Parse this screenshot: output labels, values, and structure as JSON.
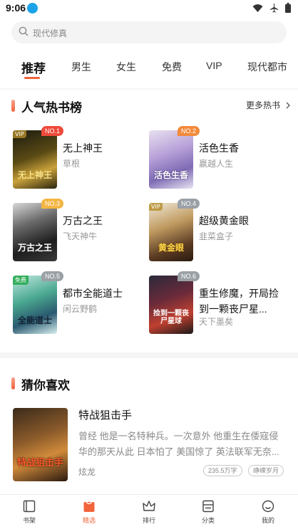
{
  "status": {
    "time": "9:06"
  },
  "search": {
    "placeholder": "现代修真"
  },
  "tabs": [
    {
      "label": "推荐",
      "active": true
    },
    {
      "label": "男生"
    },
    {
      "label": "女生"
    },
    {
      "label": "免费"
    },
    {
      "label": "VIP"
    },
    {
      "label": "现代都市"
    }
  ],
  "hot_list": {
    "title": "人气热书榜",
    "more": "更多热书",
    "items": [
      {
        "rank": "NO.1",
        "name": "无上神王",
        "author": "草根",
        "cover_title": "无上神王",
        "tag": "VIP"
      },
      {
        "rank": "NO.2",
        "name": "活色生香",
        "author": "嬴越人生",
        "cover_title": "活色生香",
        "tag": ""
      },
      {
        "rank": "NO.3",
        "name": "万古之王",
        "author": "飞天神牛",
        "cover_title": "万古之王",
        "tag": ""
      },
      {
        "rank": "NO.4",
        "name": "超级黄金眼",
        "author": "韭菜盒子",
        "cover_title": "黄金眼",
        "tag": "VIP"
      },
      {
        "rank": "NO.5",
        "name": "都市全能道士",
        "author": "闲云野鹤",
        "cover_title": "全能道士",
        "tag": "免费"
      },
      {
        "rank": "NO.6",
        "name": "重生修魔，开局捡到一颗丧尸星...",
        "author": "天下墨矣",
        "cover_title": "捡到一颗丧尸星球",
        "tag": ""
      }
    ]
  },
  "guess": {
    "title": "猜你喜欢",
    "book": {
      "title": "特战狙击手",
      "desc": "曾经 他是一名特种兵。一次意外 他重生在倭寇侵华的那天从此 日本怕了 美国惊了 英法联军无奈...",
      "author": "炫龙",
      "words": "235.5万字",
      "status": "峥嵘岁月",
      "cover_title": "特战狙击手"
    }
  },
  "bottom_nav": [
    {
      "label": "书架",
      "icon": "bookshelf-icon"
    },
    {
      "label": "精选",
      "icon": "featured-icon",
      "active": true
    },
    {
      "label": "排行",
      "icon": "crown-icon"
    },
    {
      "label": "分类",
      "icon": "category-icon"
    },
    {
      "label": "我的",
      "icon": "profile-icon"
    }
  ],
  "colors": {
    "accent": "#f2643c",
    "badge_no1": "#ee4a3a",
    "badge_no2": "#f28a3b",
    "badge_no3": "#f4b542",
    "badge_rest": "#9aa0a6"
  }
}
